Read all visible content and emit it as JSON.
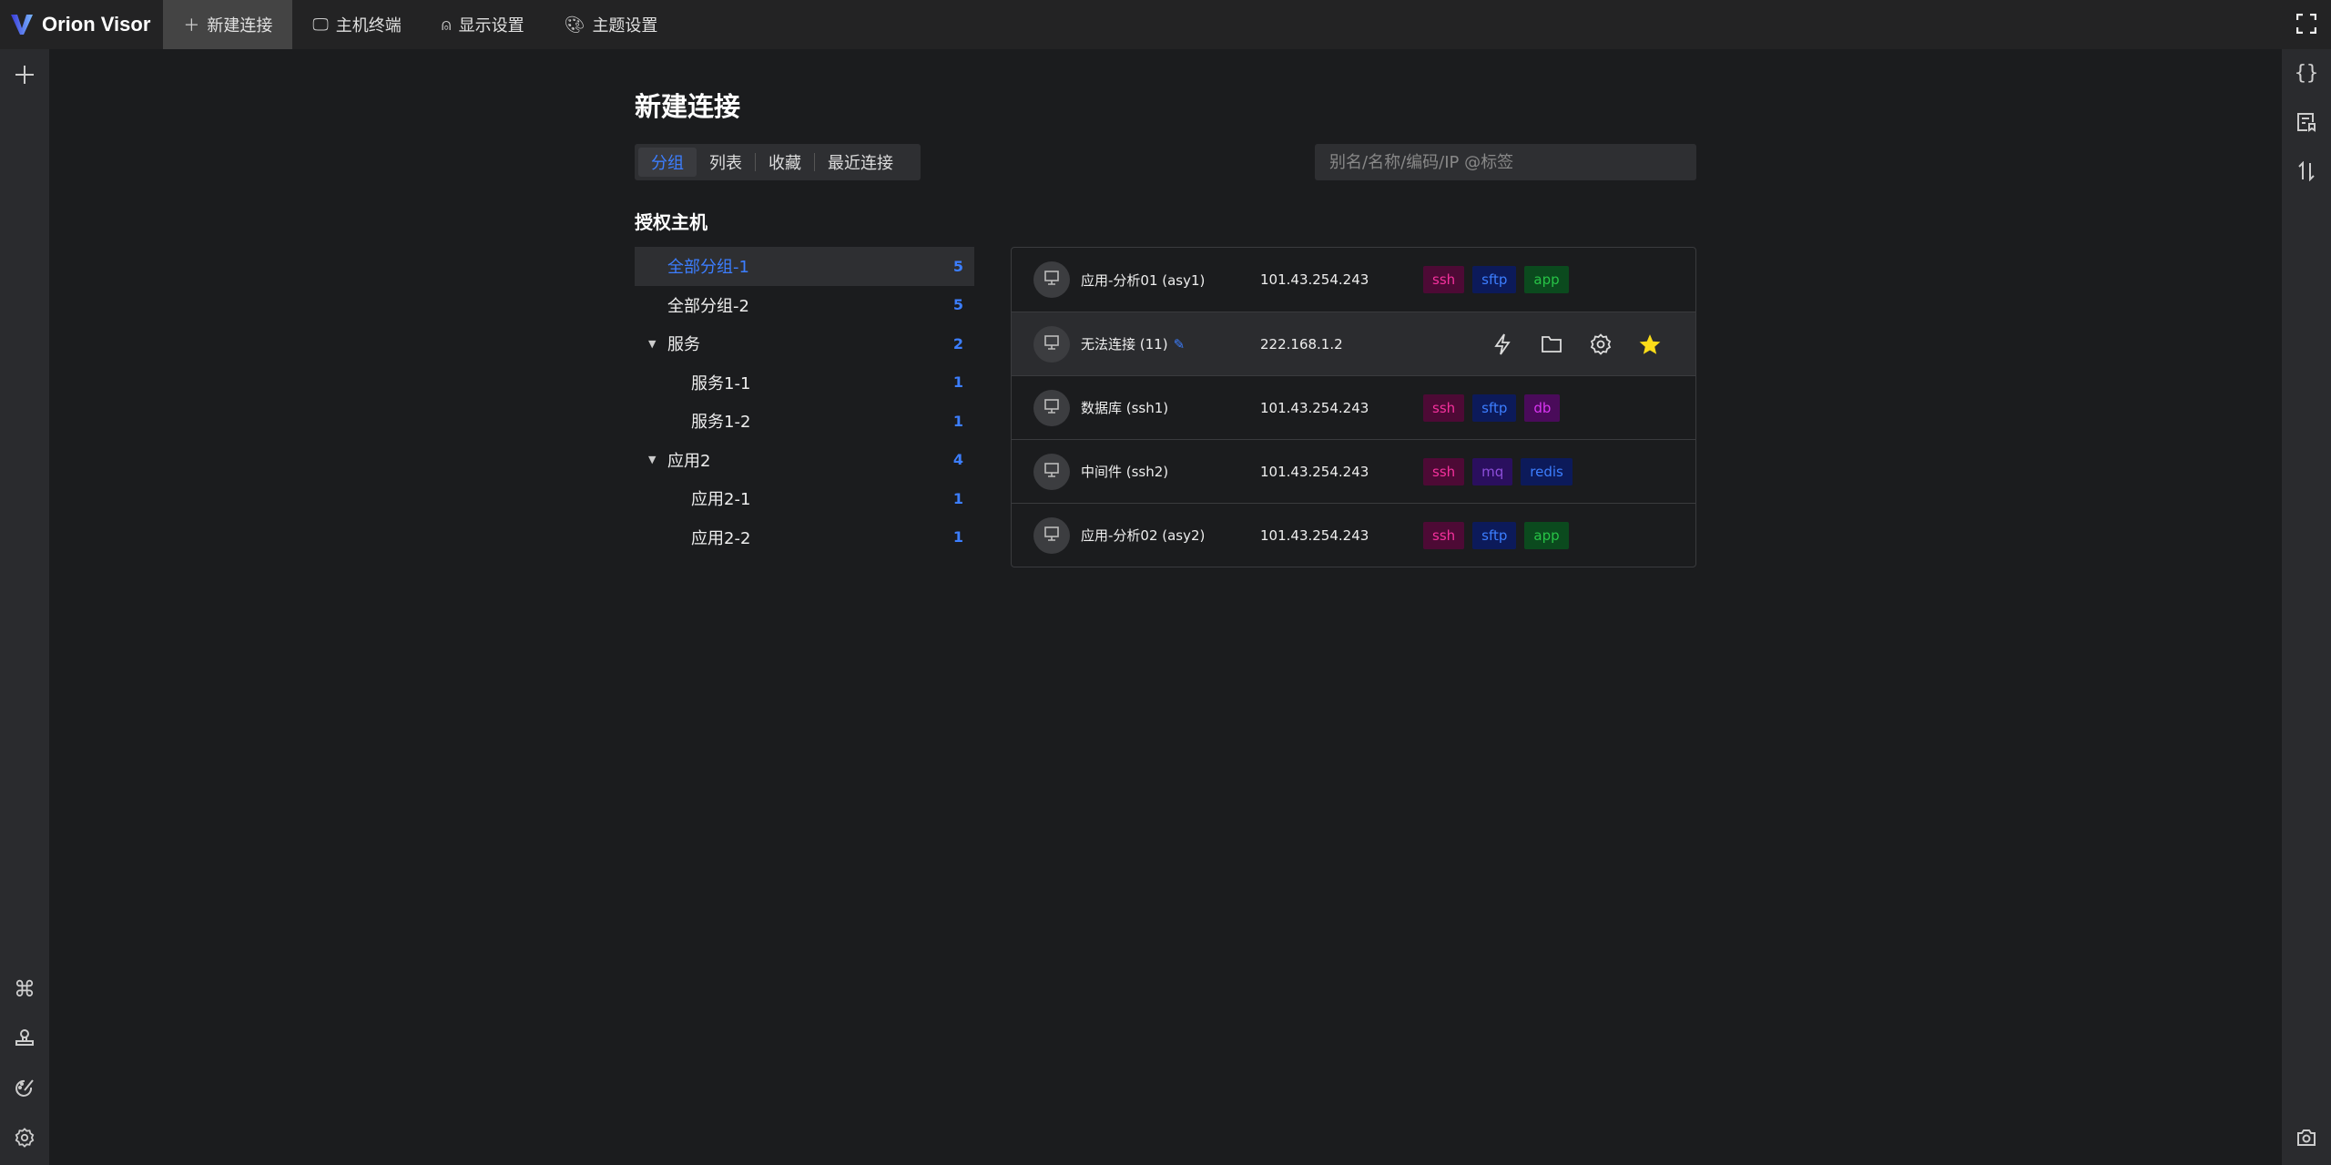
{
  "app": {
    "name": "Orion Visor"
  },
  "topbar": {
    "tabs": [
      {
        "label": "新建连接",
        "icon": "plus-icon",
        "active": true
      },
      {
        "label": "主机终端",
        "icon": "desktop-icon"
      },
      {
        "label": "显示设置",
        "icon": "stamp-icon"
      },
      {
        "label": "主题设置",
        "icon": "palette-icon"
      }
    ]
  },
  "page": {
    "title": "新建连接",
    "section": "授权主机"
  },
  "view_tabs": [
    {
      "label": "分组",
      "active": true
    },
    {
      "label": "列表"
    },
    {
      "label": "收藏"
    },
    {
      "label": "最近连接"
    }
  ],
  "search": {
    "placeholder": "别名/名称/编码/IP @标签",
    "value": ""
  },
  "tree": [
    {
      "label": "全部分组-1",
      "count": "5",
      "level": 0,
      "selected": true
    },
    {
      "label": "全部分组-2",
      "count": "5",
      "level": 0
    },
    {
      "label": "服务",
      "count": "2",
      "level": 0,
      "expanded": true
    },
    {
      "label": "服务1-1",
      "count": "1",
      "level": 1
    },
    {
      "label": "服务1-2",
      "count": "1",
      "level": 1
    },
    {
      "label": "应用2",
      "count": "4",
      "level": 0,
      "expanded": true
    },
    {
      "label": "应用2-1",
      "count": "1",
      "level": 1
    },
    {
      "label": "应用2-2",
      "count": "1",
      "level": 1
    }
  ],
  "hosts": [
    {
      "name": "应用-分析01 (asy1)",
      "ip": "101.43.254.243",
      "tags": [
        "ssh",
        "sftp",
        "app"
      ]
    },
    {
      "name": "无法连接 (11)",
      "ip": "222.168.1.2",
      "hover": true,
      "tags": []
    },
    {
      "name": "数据库 (ssh1)",
      "ip": "101.43.254.243",
      "tags": [
        "ssh",
        "sftp",
        "db"
      ]
    },
    {
      "name": "中间件 (ssh2)",
      "ip": "101.43.254.243",
      "tags": [
        "ssh",
        "mq",
        "redis"
      ]
    },
    {
      "name": "应用-分析02 (asy2)",
      "ip": "101.43.254.243",
      "tags": [
        "ssh",
        "sftp",
        "app"
      ]
    }
  ],
  "tag_colors": {
    "ssh": {
      "bg": "#4d0a35",
      "fg": "#f5319d"
    },
    "sftp": {
      "bg": "#0c1a5a",
      "fg": "#3c7eff"
    },
    "app": {
      "bg": "#0b4a1e",
      "fg": "#27c346"
    },
    "db": {
      "bg": "#4a0b5a",
      "fg": "#d935f2"
    },
    "mq": {
      "bg": "#2a0f5e",
      "fg": "#8d4eda"
    },
    "redis": {
      "bg": "#0c1a5a",
      "fg": "#3c7eff"
    }
  },
  "colors": {
    "accent": "#3c7eff",
    "star": "#fadc19"
  }
}
